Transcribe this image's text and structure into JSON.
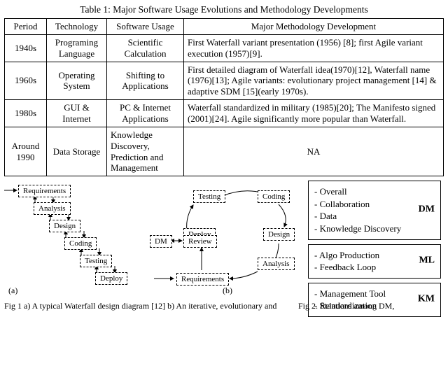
{
  "table": {
    "caption": "Table 1: Major Software Usage Evolutions and Methodology Developments",
    "headers": [
      "Period",
      "Technology",
      "Software Usage",
      "Major Methodology Development"
    ],
    "rows": [
      {
        "period": "1940s",
        "tech": "Programing Language",
        "usage": "Scientific Calculation",
        "method": "First Waterfall variant presentation (1956) [8]; first Agile variant execution (1957)[9]."
      },
      {
        "period": "1960s",
        "tech": "Operating System",
        "usage": "Shifting to Applications",
        "method": "First detailed diagram of Waterfall idea(1970)[12], Waterfall name (1976)[13]; Agile variants: evolutionary project management [14] & adaptive SDM [15](early 1970s)."
      },
      {
        "period": "1980s",
        "tech": "GUI & Internet",
        "usage": "PC & Internet Applications",
        "method": "Waterfall standardized in military (1985)[20]; The Manifesto signed (2001)[24]. Agile significantly more popular than Waterfall."
      },
      {
        "period": "Around 1990",
        "tech": "Data Storage",
        "usage": "Knowledge Discovery, Prediction and Management",
        "method": "NA"
      }
    ]
  },
  "figA": {
    "steps": [
      "Requirements",
      "Analysis",
      "Design",
      "Coding",
      "Testing",
      "Deploy"
    ],
    "tag": "(a)"
  },
  "figB": {
    "nodes": {
      "testing": "Testing",
      "coding": "Coding",
      "deploy": "Deploy",
      "design": "Design",
      "dm": "DM",
      "review": "Review",
      "analysis": "Analysis",
      "requirements": "Requirements"
    },
    "tag": "(b)"
  },
  "figC": {
    "dm": {
      "label": "DM",
      "items": [
        "Overall",
        "Collaboration",
        "Data",
        "Knowledge Discovery"
      ]
    },
    "ml": {
      "label": "ML",
      "items": [
        "Algo Production",
        "Feedback Loop"
      ]
    },
    "km": {
      "label": "KM",
      "items": [
        "Management Tool",
        "Standardization"
      ]
    }
  },
  "captions": {
    "fig1": "Fig 1 a) A typical Waterfall design diagram [12] b) An iterative, evolutionary and",
    "fig2": "Fig 2. Relations among DM,"
  }
}
